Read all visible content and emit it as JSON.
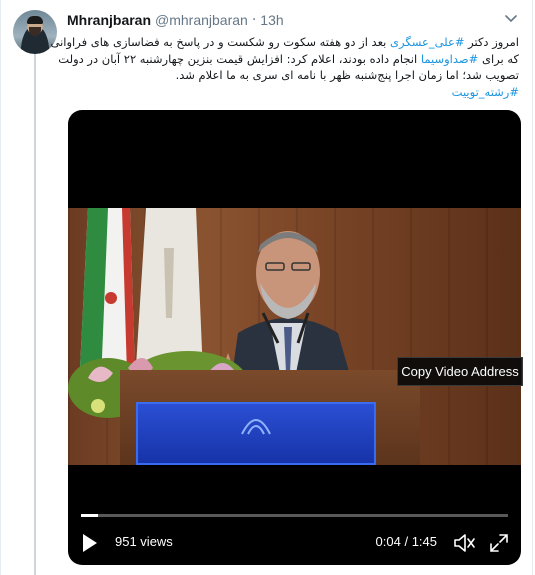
{
  "tweet": {
    "display_name": "Mhranjbaran",
    "handle": "@mhranjbaran",
    "separator": "·",
    "time": "13h",
    "text_lines": [
      [
        {
          "t": "امروز دکتر ",
          "tag": false
        },
        {
          "t": "#علی_عسگری",
          "tag": true
        },
        {
          "t": " بعد از دو هفته سکوت رو شکست و در پاسخ به فضاسازی های فراوانی",
          "tag": false
        }
      ],
      [
        {
          "t": "که برای ",
          "tag": false
        },
        {
          "t": "#صداوسیما",
          "tag": true
        },
        {
          "t": " انجام داده بودند، اعلام کرد: افزایش قیمت بنزین چهارشنبه ۲۲ آبان در دولت",
          "tag": false
        }
      ],
      [
        {
          "t": "تصویب شد؛ اما زمان اجرا پنج‌شنبه ظهر با نامه ای سری به ما اعلام شد.",
          "tag": false
        }
      ],
      [
        {
          "t": "#رشته_توییت",
          "tag": true
        }
      ]
    ]
  },
  "video": {
    "tooltip": "Copy Video Address",
    "views": "951 views",
    "current_time": "0:04",
    "duration": "1:45",
    "time_separator": " / ",
    "progress_fraction": 0.04
  },
  "icons": {
    "caret": "chevron-down-icon",
    "play": "play-icon",
    "volume": "volume-muted-icon",
    "fullscreen": "fullscreen-icon"
  },
  "colors": {
    "link": "#1b95e0",
    "text": "#14171a",
    "secondary": "#657786"
  }
}
